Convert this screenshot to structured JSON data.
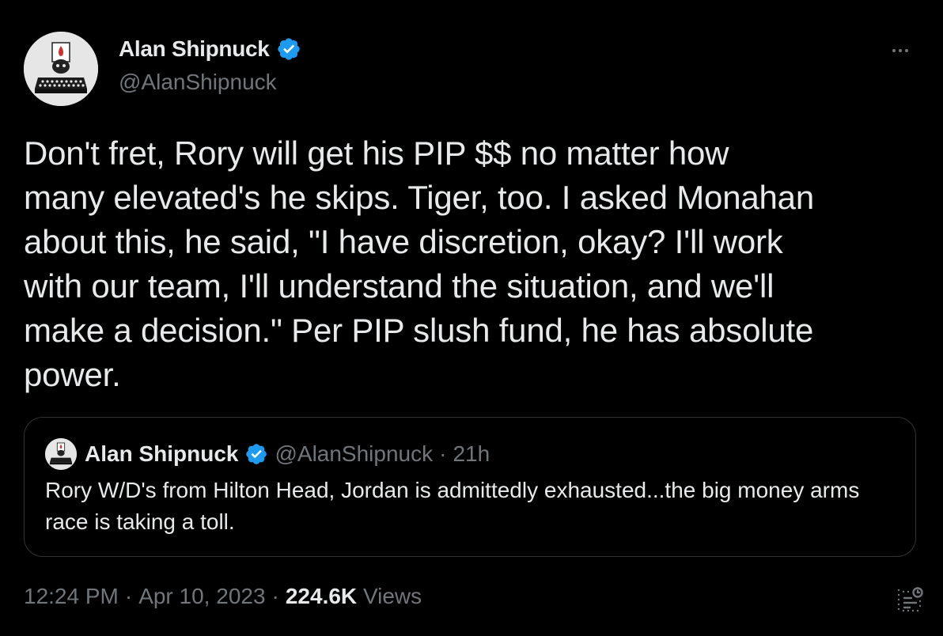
{
  "author": {
    "name": "Alan Shipnuck",
    "handle": "@AlanShipnuck",
    "verified": true,
    "avatar_icon": "typewriter-icon"
  },
  "tweet": {
    "text": "Don't fret, Rory will get his PIP $$ no matter how\nmany elevated's he skips. Tiger, too. I asked Monahan\nabout this, he said, \"I have discretion, okay? I'll work\nwith our team, I'll understand the situation, and we'll\nmake a decision.\" Per PIP slush fund, he has absolute\npower."
  },
  "quote": {
    "author_name": "Alan Shipnuck",
    "author_handle": "@AlanShipnuck",
    "separator": "·",
    "time": "21h",
    "text": "Rory W/D's from Hilton Head, Jordan is admittedly exhausted...the big money arms race is taking a toll."
  },
  "meta": {
    "time": "12:24 PM",
    "separator": "·",
    "date": "Apr 10, 2023",
    "views_count": "224.6K",
    "views_label": "Views"
  },
  "icons": {
    "verified": "verified-badge-icon",
    "more": "more-icon",
    "analytics": "analytics-icon"
  },
  "colors": {
    "background": "#000000",
    "text": "#e7e9ea",
    "secondary_text": "#71767b",
    "verified": "#1d9bf0",
    "border": "#2f3336"
  }
}
